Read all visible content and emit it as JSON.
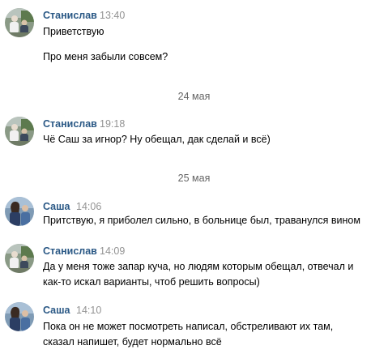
{
  "messages": [
    {
      "author": "Станислав",
      "time": "13:40",
      "lines": [
        "Приветствую",
        "",
        "Про меня забыли совсем?"
      ]
    },
    {
      "author": "Станислав",
      "time": "19:18",
      "lines": [
        "Чё Саш за игнор? Ну обещал, дак сделай и всё)"
      ]
    },
    {
      "author": "Саша",
      "time": "14:06",
      "lines": [
        "Притствую, я приболел сильно, в больнице был, траванулся вином"
      ]
    },
    {
      "author": "Станислав",
      "time": "14:09",
      "lines": [
        "Да у меня тоже запар куча, но людям которым обещал, отвечал и",
        "как-то искал варианты, чтоб решить вопросы)"
      ]
    },
    {
      "author": "Саша",
      "time": "14:10",
      "lines": [
        "Пока он не может посмотреть написал, обстреливают их там,",
        "сказал напишет, будет нормально всё"
      ]
    }
  ],
  "date_separators": [
    "24 мая",
    "25 мая"
  ],
  "colors": {
    "author": "#2a5885",
    "time": "#939393",
    "date": "#656565",
    "text": "#000000"
  },
  "avatars": {
    "stanislav": "avatar-stanislav-photo",
    "sasha": "avatar-sasha-photo"
  }
}
